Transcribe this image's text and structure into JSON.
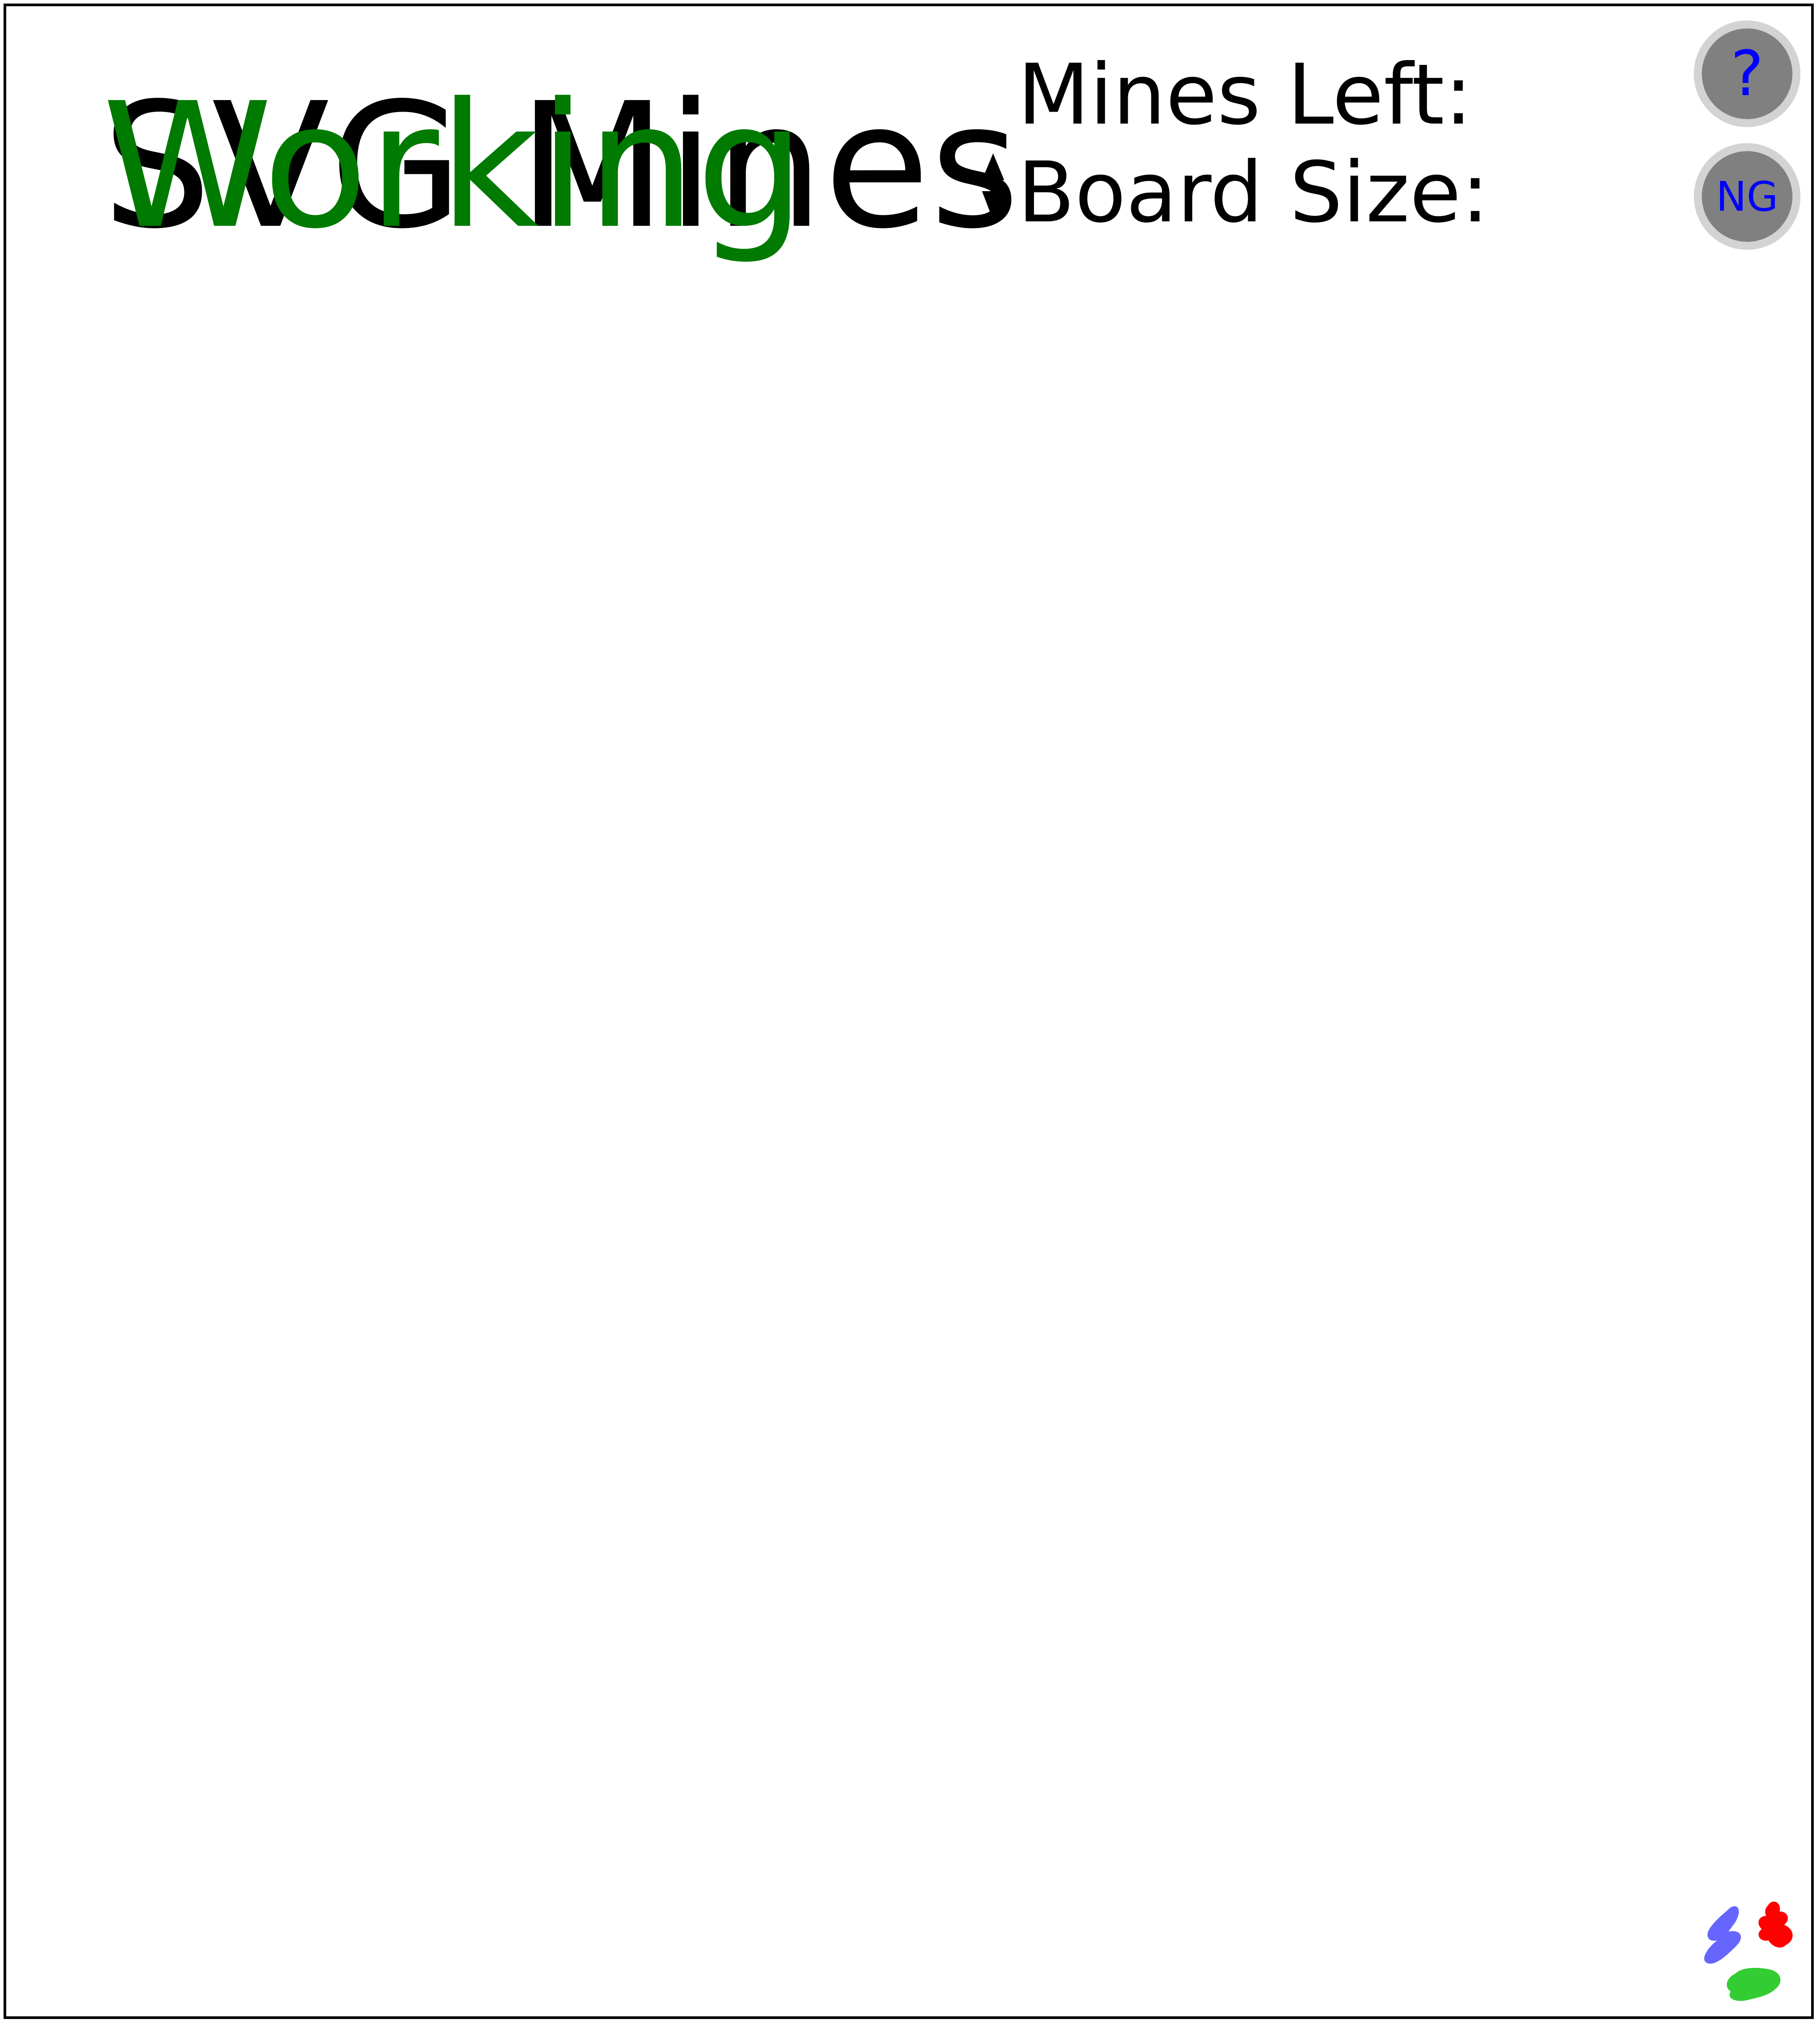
{
  "header": {
    "title": "SVG Mines",
    "status": "Working",
    "mines_left_label": "Mines Left:",
    "board_size_label": "Board Size:"
  },
  "buttons": {
    "help_label": "?",
    "new_game_label": "NG"
  },
  "colors": {
    "status": "#007a00",
    "button_text": "#0000ff",
    "button_fill": "#808080",
    "button_ring": "#d3d3d3",
    "logo_blue": "#6666ff",
    "logo_red": "#ff0000",
    "logo_green": "#33cc33"
  }
}
